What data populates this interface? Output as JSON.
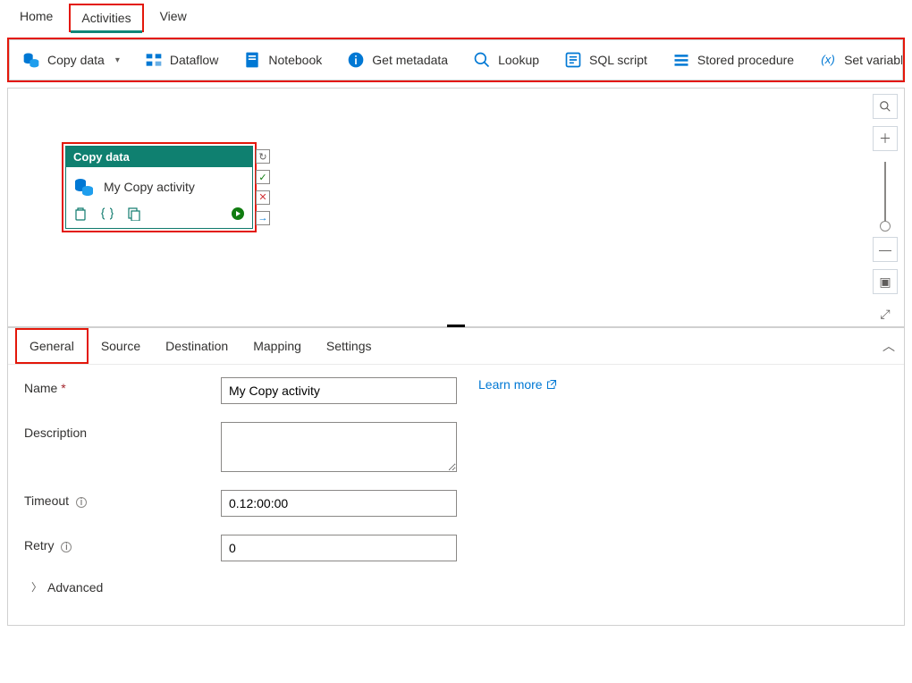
{
  "top_tabs": {
    "home": "Home",
    "activities": "Activities",
    "view": "View"
  },
  "ribbon": {
    "copy_data": "Copy data",
    "dataflow": "Dataflow",
    "notebook": "Notebook",
    "get_metadata": "Get metadata",
    "lookup": "Lookup",
    "sql_script": "SQL script",
    "stored_procedure": "Stored procedure",
    "set_variable": "Set variable"
  },
  "node": {
    "type_label": "Copy data",
    "name": "My Copy activity"
  },
  "props_tabs": {
    "general": "General",
    "source": "Source",
    "destination": "Destination",
    "mapping": "Mapping",
    "settings": "Settings"
  },
  "form": {
    "name_label": "Name",
    "name_value": "My Copy activity",
    "learn_more": "Learn more",
    "description_label": "Description",
    "description_value": "",
    "timeout_label": "Timeout",
    "timeout_value": "0.12:00:00",
    "retry_label": "Retry",
    "retry_value": "0",
    "advanced": "Advanced"
  }
}
